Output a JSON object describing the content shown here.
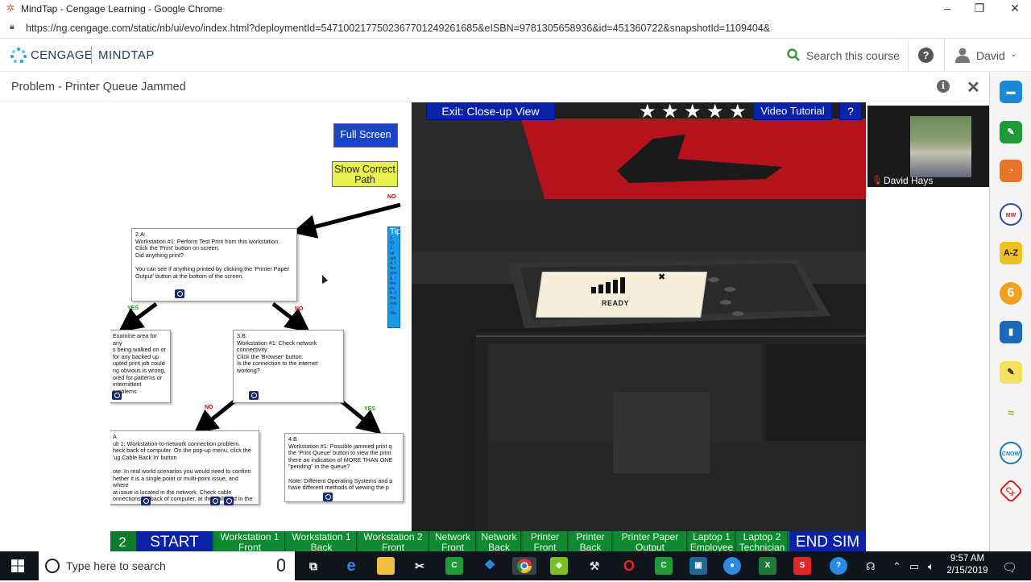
{
  "browser": {
    "window_title": "MindTap - Cengage Learning - Google Chrome",
    "url": "https://ng.cengage.com/static/nb/ui/evo/index.html?deploymentId=5471002177502367701249261685&eISBN=9781305658936&id=451360722&snapshotId=1109404&"
  },
  "header": {
    "brand": "CENGAGE",
    "product": "MINDTAP",
    "search_label": "Search this course",
    "user_name": "David"
  },
  "activity": {
    "title": "Problem - Printer Queue Jammed"
  },
  "flowchart": {
    "full_screen": "Full Screen",
    "show_correct_path": "Show Correct Path",
    "tip_label": "Tip",
    "tip_lines": [
      "1.",
      "Cl",
      "2.",
      "Hi",
      "arti",
      "4. I",
      "fee",
      "you",
      "5. I",
      "the",
      "pa",
      "6. I",
      "tha",
      "rele",
      "7.",
      "We"
    ],
    "boxes": {
      "b2a": "2.A:\nWorkstation #1: Perform Test Print from this workstation.\nClick the 'Print' button on screen.\nDid anything print?\n\nYou can see if anything printed by clicking the 'Printer Paper Output' button at the bottom of the screen.",
      "left": "Examine area for any\ns being walked on or\nfor any backed up\nupted print job could\nng obvious is wrong,\nored for patterns or\nintermittent problems",
      "b3b": "3.B:\nWorkstation #1: Check network connectivity.\nClick the 'Browser' button.\nIs the connection to the internet working?",
      "bottom_left": "A\nult 1: Workstation-to-network connection problem.\nheck back of computer. On the pop-up menu, click the\n'ug Cable Back In' button\n\note: In real world scenarios you would need to confirm\nhether it is a single point or multi-point issue, and where\nat issue is located in the network. Check cable\nonnections on back of computer, at the wall, and in the\nata room leading to the switch/router.",
      "b4b": "4.B\nWorkstation #1: Possible jammed print q\nthe 'Print Queue' button to view the print\nthere an indication of MORE THAN ONE\n\"pending\" in the queue?\n\nNote: Different Operating Systems and p\nhave different methods of viewing the p"
    },
    "labels": {
      "yes": "YES",
      "no": "NO"
    }
  },
  "sim": {
    "exit_closeup": "Exit: Close-up View",
    "video_tutorial": "Video Tutorial",
    "help": "?",
    "rating_stars": 5,
    "printer_status": "READY"
  },
  "video": {
    "participant": "David Hays"
  },
  "simnav": {
    "step": "2",
    "start": "START",
    "end": "END SIM",
    "buttons": [
      "Workstation 1 Front",
      "Workstation 1 Back",
      "Workstation 2 Front",
      "Network Front",
      "Network Back",
      "Printer Front",
      "Printer Back",
      "Printer Paper Output",
      "Laptop 1 Employee",
      "Laptop 2 Technician"
    ]
  },
  "taskbar": {
    "search_placeholder": "Type here to search",
    "time": "9:57 AM",
    "date": "2/15/2019"
  }
}
